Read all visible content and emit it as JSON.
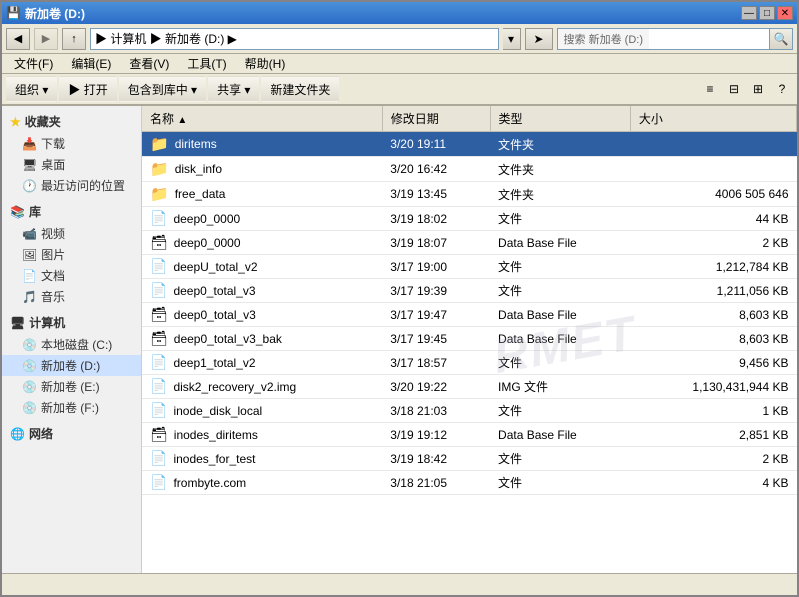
{
  "window": {
    "title": "新加卷 (D:)",
    "title_icon": "💾"
  },
  "controls": {
    "minimize": "—",
    "maximize": "□",
    "close": "✕"
  },
  "address": {
    "path": " ▶ 计算机 ▶ 新加卷 (D:) ▶",
    "search_label": "搜索 新加卷 (D:)",
    "search_placeholder": ""
  },
  "menubar": {
    "items": [
      "文件(F)",
      "编辑(E)",
      "查看(V)",
      "工具(T)",
      "帮助(H)"
    ]
  },
  "toolbar": {
    "organize": "组织 ▾",
    "open": "▶ 打开",
    "include_library": "包含到库中 ▾",
    "share": "共享 ▾",
    "new_folder": "新建文件夹",
    "view_label": "⊞"
  },
  "sidebar": {
    "favorites_label": "收藏夹",
    "favorites_items": [
      {
        "id": "downloads",
        "label": "下载",
        "icon": "📥"
      },
      {
        "id": "desktop",
        "label": "桌面",
        "icon": "🖥"
      },
      {
        "id": "recent",
        "label": "最近访问的位置",
        "icon": "🕐"
      }
    ],
    "library_label": "库",
    "library_items": [
      {
        "id": "video",
        "label": "视频",
        "icon": "📹"
      },
      {
        "id": "pictures",
        "label": "图片",
        "icon": "🖼"
      },
      {
        "id": "documents",
        "label": "文档",
        "icon": "📄"
      },
      {
        "id": "music",
        "label": "音乐",
        "icon": "🎵"
      }
    ],
    "computer_label": "计算机",
    "computer_items": [
      {
        "id": "local-c",
        "label": "本地磁盘 (C:)",
        "icon": "💿",
        "selected": false
      },
      {
        "id": "new-d",
        "label": "新加卷 (D:)",
        "icon": "💿",
        "selected": true
      },
      {
        "id": "new-e",
        "label": "新加卷 (E:)",
        "icon": "💿",
        "selected": false
      },
      {
        "id": "new-f",
        "label": "新加卷 (F:)",
        "icon": "💿",
        "selected": false
      }
    ],
    "network_label": "网络"
  },
  "columns": [
    {
      "id": "name",
      "label": "名称",
      "sort": "▲"
    },
    {
      "id": "modified",
      "label": "修改日期"
    },
    {
      "id": "type",
      "label": "类型"
    },
    {
      "id": "size",
      "label": "大小"
    }
  ],
  "files": [
    {
      "name": "diritems",
      "modified": "3/20 19:11",
      "type": "文件夹",
      "size": "",
      "icon": "folder",
      "selected": true
    },
    {
      "name": "disk_info",
      "modified": "3/20 16:42",
      "type": "文件夹",
      "size": "",
      "icon": "folder",
      "selected": false
    },
    {
      "name": "free_data",
      "modified": "3/19 13:45",
      "type": "文件夹",
      "size": "4006 505 646",
      "icon": "folder",
      "selected": false
    },
    {
      "name": "deep0_0000",
      "modified": "3/19 18:02",
      "type": "文件",
      "size": "44 KB",
      "icon": "file",
      "selected": false
    },
    {
      "name": "deep0_0000",
      "modified": "3/19 18:07",
      "type": "Data Base File",
      "size": "2 KB",
      "icon": "db",
      "selected": false
    },
    {
      "name": "deepU_total_v2",
      "modified": "3/17 19:00",
      "type": "文件",
      "size": "1,212,784 KB",
      "icon": "file",
      "selected": false
    },
    {
      "name": "deep0_total_v3",
      "modified": "3/17 19:39",
      "type": "文件",
      "size": "1,211,056 KB",
      "icon": "file",
      "selected": false
    },
    {
      "name": "deep0_total_v3",
      "modified": "3/17 19:47",
      "type": "Data Base File",
      "size": "8,603 KB",
      "icon": "db",
      "selected": false
    },
    {
      "name": "deep0_total_v3_bak",
      "modified": "3/17 19:45",
      "type": "Data Base File",
      "size": "8,603 KB",
      "icon": "db",
      "selected": false
    },
    {
      "name": "deep1_total_v2",
      "modified": "3/17 18:57",
      "type": "文件",
      "size": "9,456 KB",
      "icon": "file",
      "selected": false
    },
    {
      "name": "disk2_recovery_v2.img",
      "modified": "3/20 19:22",
      "type": "IMG 文件",
      "size": "1,130,431,944 KB",
      "icon": "file",
      "selected": false
    },
    {
      "name": "inode_disk_local",
      "modified": "3/18 21:03",
      "type": "文件",
      "size": "1 KB",
      "icon": "file",
      "selected": false
    },
    {
      "name": "inodes_diritems",
      "modified": "3/19 19:12",
      "type": "Data Base File",
      "size": "2,851 KB",
      "icon": "db",
      "selected": false
    },
    {
      "name": "inodes_for_test",
      "modified": "3/19 18:42",
      "type": "文件",
      "size": "2 KB",
      "icon": "file",
      "selected": false
    },
    {
      "name": "frombyte.com",
      "modified": "3/18 21:05",
      "type": "文件",
      "size": "4 KB",
      "icon": "file",
      "selected": false
    }
  ],
  "watermark": "RMET",
  "statusbar": {
    "text": ""
  }
}
